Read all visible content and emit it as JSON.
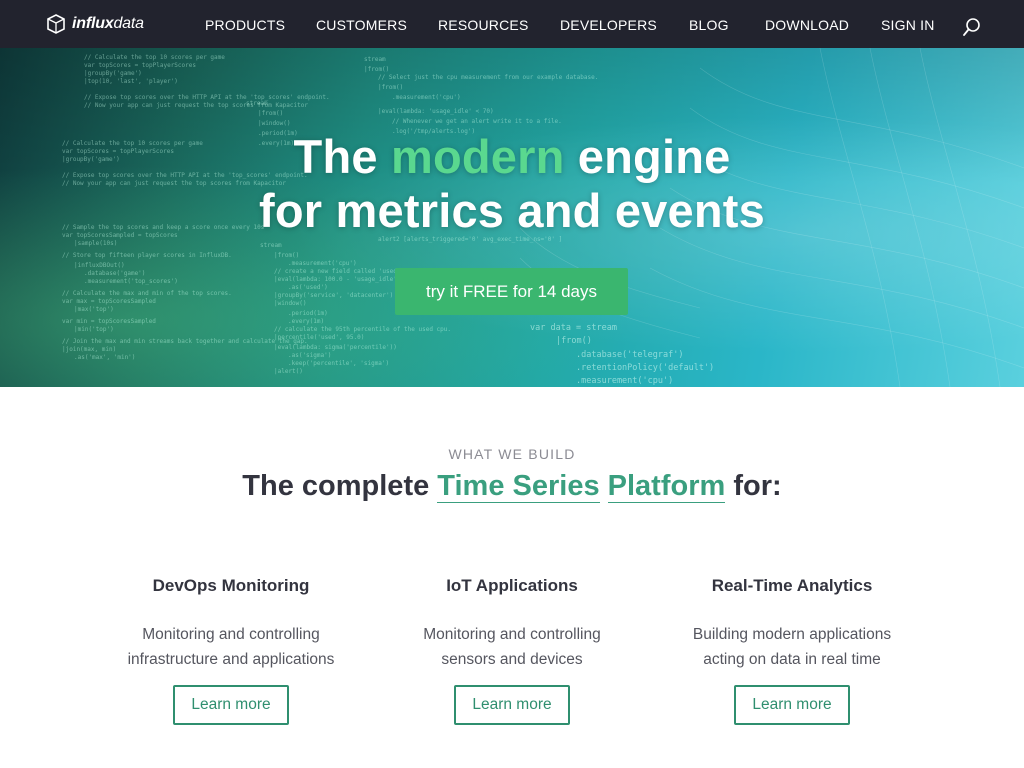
{
  "brand": {
    "logo_text_bold": "influx",
    "logo_text_thin": "data"
  },
  "nav": {
    "items": [
      "PRODUCTS",
      "CUSTOMERS",
      "RESOURCES",
      "DEVELOPERS",
      "BLOG",
      "DOWNLOAD",
      "SIGN IN"
    ],
    "search_icon": "search-icon"
  },
  "hero": {
    "title_prefix": "The",
    "title_accent": "modern",
    "title_suffix": "engine",
    "title_line2": "for metrics and events",
    "cta_label": "try it FREE for 14 days",
    "code_snippets": [
      "var data = stream",
      "|from()",
      ".database('telegraf')",
      ".retentionPolicy('default')",
      ".measurement('cpu')",
      "// Select just the cpu measurement from our example database.",
      "stream",
      "|from()",
      ".measurement('cpu')",
      "|eval(lambda: 'usage_idle' < 70)",
      "// Whenever we get an alert write it to a file.",
      ".log('/tmp/alerts.log')",
      "// create a new field called 'used'",
      "|eval(lambda: 100.0 - 'usage_idle')",
      ".as('used')",
      "|groupBy('service', 'datacenter')",
      "|window()",
      ".period(1m)",
      ".every(1m)",
      "// calculate the 95th percentile of the used cpu.",
      "|percentile('used', 95.0)",
      "|eval(lambda: sigma('percentile'))",
      ".as('sigma')",
      ".keep('percentile', 'sigma')",
      "|alert()",
      "// Calculate the top 10 scores per game",
      "var topScores = topPlayerScores",
      "|groupBy('game')",
      "|top(10, 'last', 'player')",
      "// Expose top scores over the HTTP API at the 'top_scores' endpoint.",
      "// Now your app can just request the top scores from Kapacitor",
      "// Sample the top scores and keep a score once every 10s",
      "var topScoresSampled = topScores",
      "|sample(10s)",
      "// Store top fifteen player scores in InfluxDB.",
      "|influxDBOut()",
      ".database('game')",
      ".measurement('top_scores')",
      "// Calculate the max and min of the top scores.",
      "var max = topScoresSampled",
      "|max('top')",
      "var min = topScoresSampled",
      "|min('top')",
      "// Join the max and min streams back together and calculate the gap.",
      "|join(max, min)",
      ".as('max', 'min')",
      "stream",
      ".period(1m)",
      "alert2 [alerts_triggered='0' avg_exec_time_ns='0' ]"
    ]
  },
  "section": {
    "eyebrow": "WHAT WE BUILD",
    "headline_prefix": "The complete",
    "headline_link1": "Time Series",
    "headline_link2": "Platform",
    "headline_suffix": "for:",
    "columns": [
      {
        "title": "DevOps Monitoring",
        "desc_line1": "Monitoring and controlling",
        "desc_line2": "infrastructure and applications",
        "button": "Learn more"
      },
      {
        "title": "IoT Applications",
        "desc_line1": "Monitoring and controlling",
        "desc_line2": "sensors and devices",
        "button": "Learn more"
      },
      {
        "title": "Real-Time Analytics",
        "desc_line1": "Building modern applications",
        "desc_line2": "acting on data in real time",
        "button": "Learn more"
      }
    ]
  },
  "colors": {
    "nav_bg": "#22232e",
    "accent_green": "#5ad88f",
    "cta_green": "#3ab66f",
    "link_green": "#3a9f7f",
    "hero_teal": "#22a7a6"
  }
}
